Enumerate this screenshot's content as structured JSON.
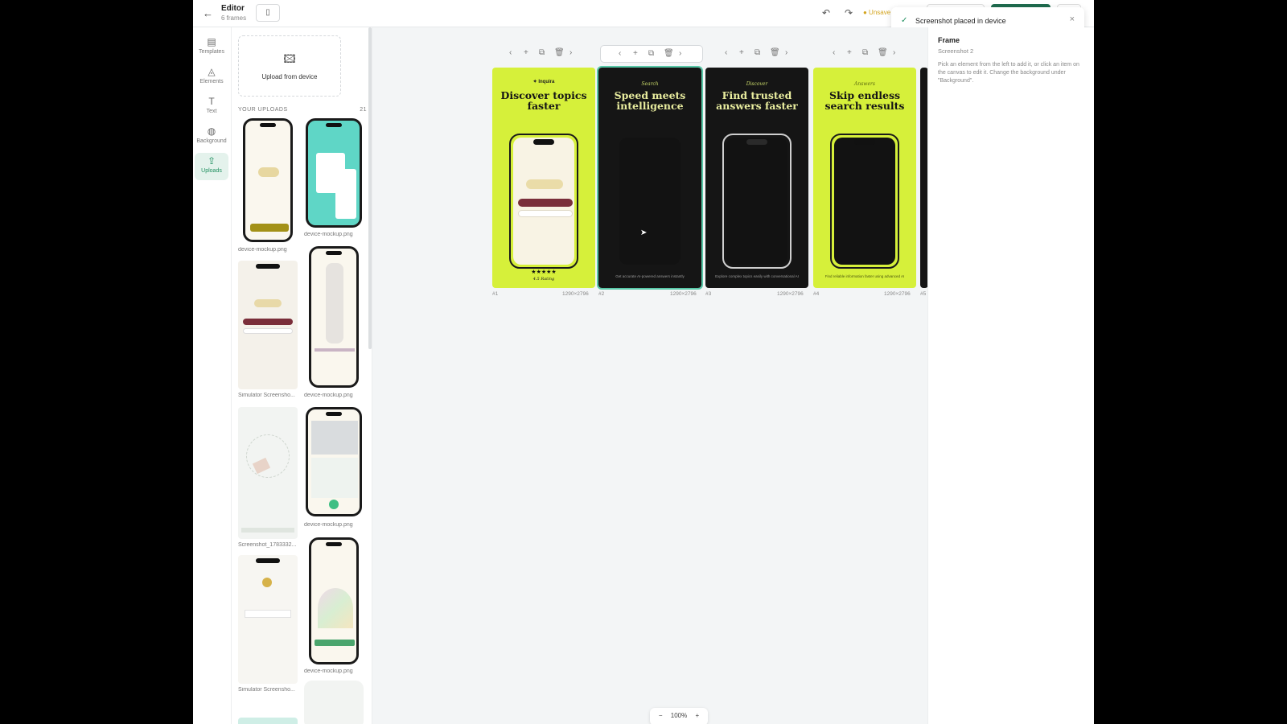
{
  "header": {
    "back_icon": "arrow-left-icon",
    "title": "Editor",
    "subtitle": "6 frames",
    "layout_icon": "sidebar-layout-icon",
    "undo_icon": "undo-icon",
    "redo_icon": "redo-icon",
    "unsaved": "● Unsave"
  },
  "toast": {
    "message": "Screenshot placed in device",
    "check_icon": "check-icon",
    "close_icon": "close-icon"
  },
  "rail": {
    "items": [
      {
        "label": "Templates",
        "icon": "templates-icon",
        "glyph": "▤"
      },
      {
        "label": "Elements",
        "icon": "elements-icon",
        "glyph": "◬"
      },
      {
        "label": "Text",
        "icon": "text-icon",
        "glyph": "T"
      },
      {
        "label": "Background",
        "icon": "palette-icon",
        "glyph": "◍"
      },
      {
        "label": "Uploads",
        "icon": "upload-icon",
        "glyph": "⇪",
        "active": true
      }
    ]
  },
  "uploads": {
    "upload_label": "Upload from device",
    "upload_icon": "image-add-icon",
    "section_title": "YOUR UPLOADS",
    "count": "21",
    "items": [
      {
        "caption": "device-mockup.png"
      },
      {
        "caption": "device-mockup.png"
      },
      {
        "caption": "Simulator Screensho..."
      },
      {
        "caption": "device-mockup.png"
      },
      {
        "caption": "Screenshot_1783332..."
      },
      {
        "caption": "device-mockup.png"
      },
      {
        "caption": "Simulator Screensho..."
      },
      {
        "caption": "device-mockup.png"
      }
    ]
  },
  "frames": [
    {
      "number": "#1",
      "size": "1290×2796",
      "brand": "✦ Inquira",
      "kicker": "",
      "headline": "Discover topics faster",
      "caption": "",
      "stars": "★★★★★",
      "rating": "4.5 Rating",
      "theme": "lime"
    },
    {
      "number": "#2",
      "size": "1290×2796",
      "brand": "",
      "kicker": "Search",
      "headline": "Speed meets intelligence",
      "caption": "Get accurate AI-powered answers instantly",
      "theme": "dark"
    },
    {
      "number": "#3",
      "size": "1290×2796",
      "brand": "",
      "kicker": "Discover",
      "headline": "Find trusted answers faster",
      "caption": "Explore complex topics easily with conversational AI",
      "theme": "dark"
    },
    {
      "number": "#4",
      "size": "1290×2796",
      "brand": "",
      "kicker": "Answers",
      "headline": "Skip endless search results",
      "caption": "Find reliable information faster using advanced AI",
      "theme": "lime"
    }
  ],
  "frame5_number": "#5",
  "toolbar_icons": [
    "chevron-left-icon",
    "plus-icon",
    "duplicate-icon",
    "trash-icon",
    "chevron-right-icon"
  ],
  "zoom": {
    "value": "100%"
  },
  "properties": {
    "heading": "Frame",
    "subheading": "Screenshot 2",
    "help": "Pick an element from the left to add it, or click an item on the canvas to edit it. Change the background under \"Background\"."
  },
  "colors": {
    "accent": "#1f8f5f",
    "lime": "#d6f03a",
    "dark": "#151515",
    "selection": "#58c8a8"
  }
}
